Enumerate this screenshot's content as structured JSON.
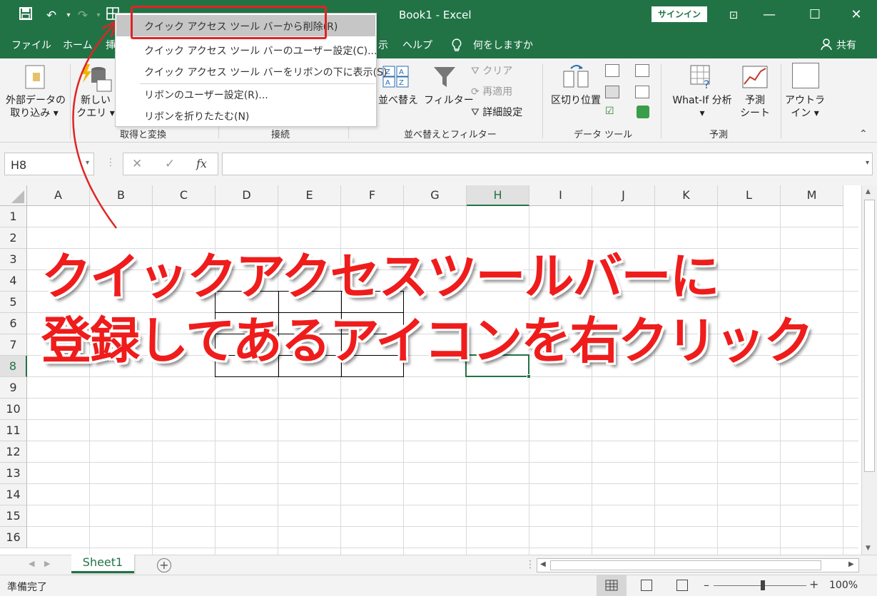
{
  "window": {
    "title": "Book1  -  Excel",
    "signin_label": "サインイン"
  },
  "tabs": {
    "file": "ファイル",
    "home": "ホーム",
    "hidden": "挿",
    "review_fragment": "示",
    "help": "ヘルプ",
    "tellme": "何をしますか",
    "share": "共有"
  },
  "context_menu": {
    "items": [
      "クイック アクセス ツール バーから削除(R)",
      "クイック アクセス ツール バーのユーザー設定(C)...",
      "クイック アクセス ツール バーをリボンの下に表示(S)",
      "リボンのユーザー設定(R)...",
      "リボンを折りたたむ(N)"
    ]
  },
  "ribbon": {
    "external_data_1": "外部データの",
    "external_data_2": "取り込み",
    "new_query_1": "新しい",
    "new_query_2": "クエリ",
    "group_get_transform": "取得と変換",
    "group_connections": "接続",
    "sort": "並べ替え",
    "filter": "フィルター",
    "clear": "クリア",
    "reapply": "再適用",
    "advanced": "詳細設定",
    "group_sort_filter": "並べ替えとフィルター",
    "text_to_columns": "区切り位置",
    "group_data_tools": "データ ツール",
    "whatif": "What-If 分析",
    "forecast_1": "予測",
    "forecast_2": "シート",
    "group_forecast": "予測",
    "addins_1": "アウトラ",
    "addins_2": "イン"
  },
  "formula_bar": {
    "name_box": "H8",
    "cancel": "✕",
    "enter": "✓",
    "fx": "fx",
    "value": ""
  },
  "grid": {
    "columns": [
      "A",
      "B",
      "C",
      "D",
      "E",
      "F",
      "G",
      "H",
      "I",
      "J",
      "K",
      "L",
      "M"
    ],
    "rows": [
      "1",
      "2",
      "3",
      "4",
      "5",
      "6",
      "7",
      "8",
      "9",
      "10",
      "11",
      "12",
      "13",
      "14",
      "15",
      "16"
    ],
    "active_cell": "H8"
  },
  "annotation": {
    "line1": "クイックアクセスツールバーに",
    "line2": "登録してあるアイコンを右クリック"
  },
  "sheets": {
    "tabs": [
      "Sheet1"
    ],
    "add": "+"
  },
  "status": {
    "ready": "準備完了",
    "zoom": "100%"
  },
  "colors": {
    "excel_green": "#217346",
    "annotation_red": "#ef1c1c"
  }
}
